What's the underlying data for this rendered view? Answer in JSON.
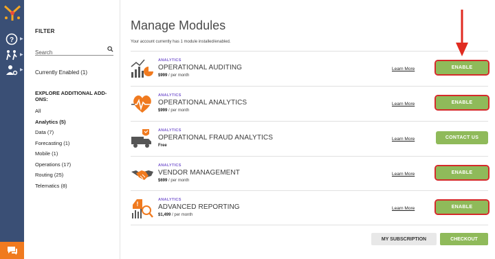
{
  "filter": {
    "heading": "FILTER",
    "search_placeholder": "Search",
    "currently_enabled": "Currently Enabled (1)",
    "explore_heading": "EXPLORE ADDITIONAL ADD-ONS:",
    "categories": [
      {
        "label": "All"
      },
      {
        "label": "Analytics (5)",
        "active": true
      },
      {
        "label": "Data (7)"
      },
      {
        "label": "Forecasting (1)"
      },
      {
        "label": "Mobile (1)"
      },
      {
        "label": "Operations (17)"
      },
      {
        "label": "Routing (25)"
      },
      {
        "label": "Telematics (8)"
      }
    ]
  },
  "main": {
    "title": "Manage Modules",
    "subtitle": "Your account currently has 1 module installed/enabled.",
    "modules": [
      {
        "category": "ANALYTICS",
        "name": "OPERATIONAL AUDITING",
        "price": "$999",
        "period": " / per month",
        "learn": "Learn More",
        "action": "ENABLE",
        "icon": "auditing-chart-icon"
      },
      {
        "category": "ANALYTICS",
        "name": "OPERATIONAL ANALYTICS",
        "price": "$999",
        "period": " / per month",
        "learn": "Learn More",
        "action": "ENABLE",
        "icon": "heart-pulse-icon"
      },
      {
        "category": "ANALYTICS",
        "name": "OPERATIONAL FRAUD ANALYTICS",
        "price": "Free",
        "period": "",
        "learn": "Learn More",
        "action": "CONTACT US",
        "icon": "fraud-truck-icon"
      },
      {
        "category": "ANALYTICS",
        "name": "VENDOR MANAGEMENT",
        "price": "$699",
        "period": " / per month",
        "learn": "Learn More",
        "action": "ENABLE",
        "icon": "handshake-icon"
      },
      {
        "category": "ANALYTICS",
        "name": "ADVANCED REPORTING",
        "price": "$1,499",
        "period": " / per month",
        "learn": "Learn More",
        "action": "ENABLE",
        "icon": "report-magnifier-icon"
      }
    ],
    "my_subscription": "MY SUBSCRIPTION",
    "checkout": "CHECKOUT"
  },
  "colors": {
    "rail": "#3a4f75",
    "accent_green": "#8fba5a",
    "category_purple": "#7a5bd0",
    "highlight_red": "#d42a2a",
    "chat_orange": "#f07a1f"
  }
}
